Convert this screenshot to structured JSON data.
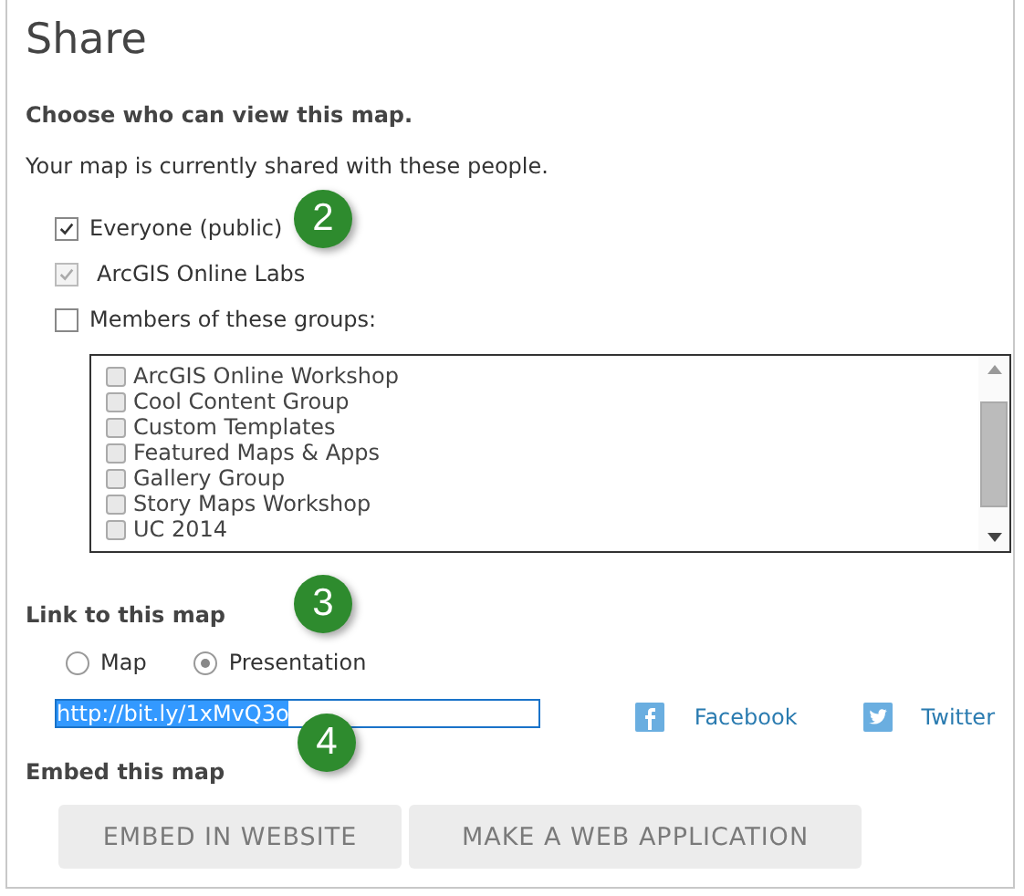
{
  "title": "Share",
  "heading": "Choose who can view this map.",
  "subtitle": "Your map is currently shared with these people.",
  "options": [
    {
      "label": "Everyone (public)",
      "checked": true,
      "disabled": false
    },
    {
      "label": "ArcGIS Online Labs",
      "checked": true,
      "disabled": true
    },
    {
      "label": "Members of these groups:",
      "checked": false,
      "disabled": false
    }
  ],
  "groups": [
    {
      "label": "ArcGIS Online Workshop",
      "checked": false
    },
    {
      "label": "Cool Content Group",
      "checked": false
    },
    {
      "label": "Custom Templates",
      "checked": false
    },
    {
      "label": "Featured Maps & Apps",
      "checked": false
    },
    {
      "label": "Gallery Group",
      "checked": false
    },
    {
      "label": "Story Maps Workshop",
      "checked": false
    },
    {
      "label": "UC 2014",
      "checked": false
    }
  ],
  "link_heading": "Link to this map",
  "link_options": [
    {
      "label": "Map",
      "selected": false
    },
    {
      "label": "Presentation",
      "selected": true
    }
  ],
  "link_value": "http://bit.ly/1xMvQ3o",
  "social": [
    {
      "label": "Facebook",
      "kind": "facebook"
    },
    {
      "label": "Twitter",
      "kind": "twitter"
    }
  ],
  "embed_heading": "Embed this map",
  "buttons": [
    "EMBED IN WEBSITE",
    "MAKE A WEB APPLICATION"
  ],
  "callouts": [
    "2",
    "3",
    "4"
  ]
}
